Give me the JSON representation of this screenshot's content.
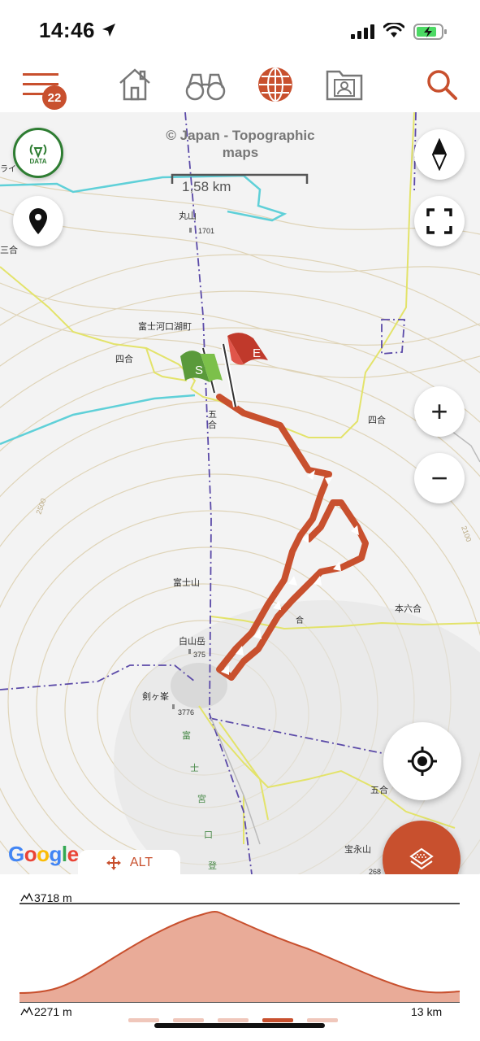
{
  "status_bar": {
    "time": "14:46"
  },
  "nav": {
    "menu_badge": "22",
    "items": [
      "menu-icon",
      "home-icon",
      "binoculars-icon",
      "globe-icon",
      "contact-folder-icon",
      "search-icon"
    ]
  },
  "map": {
    "attribution": "© Japan - Topographic maps",
    "scale_label": "1,58 km",
    "data_badge": "DATA",
    "zoom_in": "+",
    "zoom_out": "−",
    "google": [
      "G",
      "o",
      "o",
      "g",
      "l",
      "e"
    ],
    "labels": {
      "marugame": "丸山",
      "elev_1701": "1701",
      "sangou": "三合",
      "fujikawaguchiko": "富士河口湖町",
      "yongou_left": "四合",
      "yongou_right": "四合",
      "gogou_a": "五",
      "gogou_b": "合",
      "fujisan": "富士山",
      "hakusan": "白山岳",
      "elev_375": "375",
      "kengamine": "剣ヶ峯",
      "elev_3776": "3776",
      "rokugou": "本六合",
      "gogou_right": "五合",
      "houeizan": "宝永山",
      "contour_2500": "2500",
      "contour_2100": "2100",
      "raiza": "ライ",
      "miyaguchi_1": "富",
      "miyaguchi_2": "士",
      "miyaguchi_3": "宮",
      "miyaguchi_4": "口",
      "miyaguchi_5": "登",
      "gogou_small": "合",
      "elev_268": "268"
    },
    "flags": {
      "start": "S",
      "end": "E"
    },
    "alt_tab": "ALT"
  },
  "profile": {
    "max_elevation": "3718 m",
    "min_elevation": "2271 m",
    "total_distance": "13 km",
    "pages": 5,
    "active_page": 4
  },
  "colors": {
    "accent": "#c8502e",
    "track": "#c8502e",
    "contour": "#d8c9a6",
    "road_yellow": "#e3e36a",
    "river": "#5fd0d8",
    "boundary": "#5b4aa8",
    "green_flag": "#5a9a3b",
    "red_flag": "#c0392b"
  }
}
